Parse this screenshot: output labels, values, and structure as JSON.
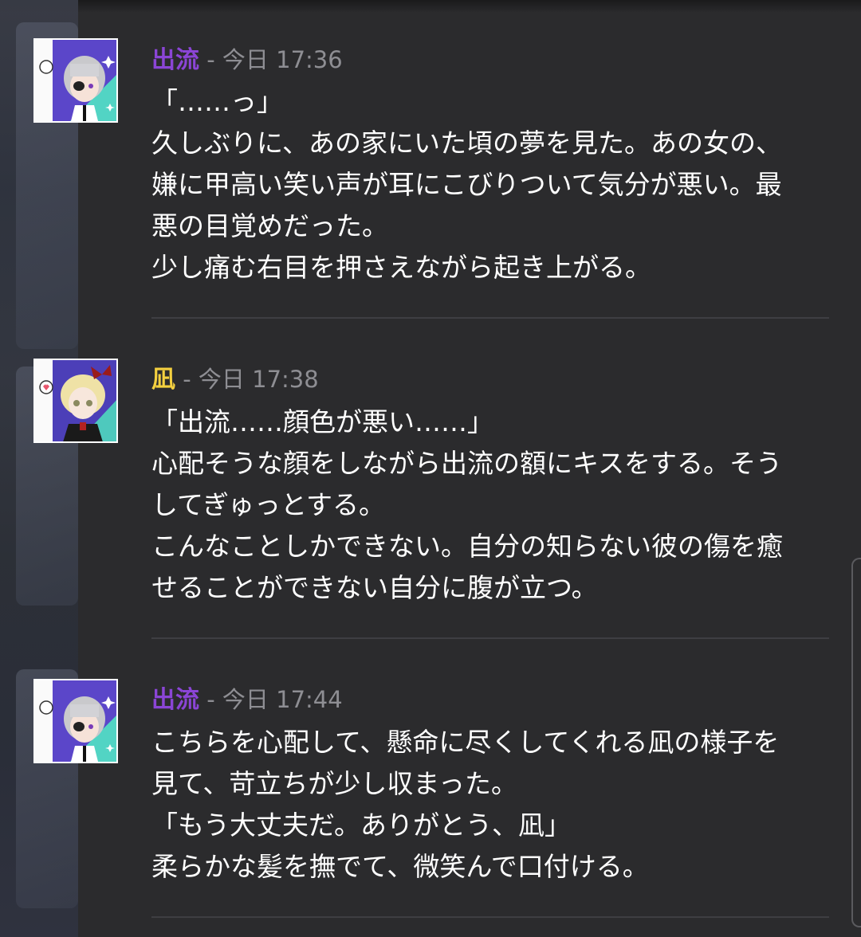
{
  "messages": [
    {
      "author": "出流",
      "author_color": "#8b45d6",
      "separator": " - ",
      "time": "今日 17:36",
      "avatar": "silver-haired-eyepatch-avatar",
      "lines": [
        "「……っ」",
        "久しぶりに、あの家にいた頃の夢を見た。あの女の、",
        "嫌に甲高い笑い声が耳にこびりついて気分が悪い。最",
        "悪の目覚めだった。",
        "少し痛む右目を押さえながら起き上がる。"
      ]
    },
    {
      "author": "凪",
      "author_color": "#f4d03f",
      "separator": " - ",
      "time": "今日 17:38",
      "avatar": "blonde-bow-avatar",
      "lines": [
        "「出流……顔色が悪い……」",
        "心配そうな顔をしながら出流の額にキスをする。そう",
        "してぎゅっとする。",
        "こんなことしかできない。自分の知らない彼の傷を癒",
        "せることができない自分に腹が立つ。"
      ]
    },
    {
      "author": "出流",
      "author_color": "#8b45d6",
      "separator": " - ",
      "time": "今日 17:44",
      "avatar": "silver-haired-eyepatch-avatar",
      "lines": [
        "こちらを心配して、懸命に尽くしてくれる凪の様子を",
        "見て、苛立ちが少し収まった。",
        "「もう大丈夫だ。ありがとう、凪」",
        "柔らかな髪を撫でて、微笑んで口付ける。"
      ]
    }
  ]
}
